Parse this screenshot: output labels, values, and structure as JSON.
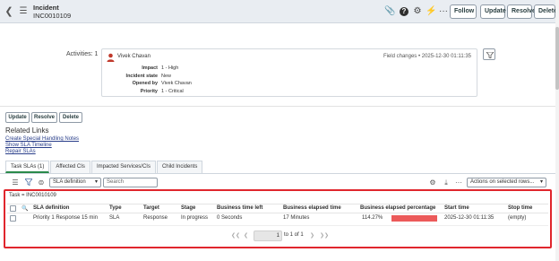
{
  "header": {
    "record_type": "Incident",
    "record_number": "INC0010109",
    "buttons": [
      "Follow",
      "Update",
      "Resolve",
      "Delete"
    ]
  },
  "activities": {
    "label": "Activities: 1",
    "author": "Vivek Chavan",
    "change_meta": "Field changes  •  2025-12-30 01:11:35",
    "fields": [
      {
        "key": "Impact",
        "value": "1 - High"
      },
      {
        "key": "Incident state",
        "value": "New"
      },
      {
        "key": "Opened by",
        "value": "Vivek Chavan"
      },
      {
        "key": "Priority",
        "value": "1 - Critical"
      }
    ]
  },
  "form_buttons": [
    "Update",
    "Resolve",
    "Delete"
  ],
  "related_links": {
    "title": "Related Links",
    "links": [
      "Create Special Handling Notes",
      "Show SLA Timeline",
      "Repair SLAs"
    ]
  },
  "tabs": [
    "Task SLAs (1)",
    "Affected CIs",
    "Impacted Services/CIs",
    "Child Incidents"
  ],
  "toolbar": {
    "field_select": "SLA definition",
    "search_placeholder": "Search",
    "actions_select": "Actions on selected rows..."
  },
  "sla_table": {
    "breadcrumb": "Task = INC0010109",
    "columns": [
      "SLA definition",
      "Type",
      "Target",
      "Stage",
      "Business time left",
      "Business elapsed time",
      "Business elapsed percentage",
      "Start time",
      "Stop time"
    ],
    "row": {
      "sla_definition": "Priority 1 Response 15 min",
      "type": "SLA",
      "target": "Response",
      "stage": "In progress",
      "business_time_left": "0 Seconds",
      "business_elapsed_time": "17 Minutes",
      "business_elapsed_percentage": "114.27%",
      "start_time": "2025-12-30 01:11:35",
      "stop_time": "(empty)"
    },
    "pagination": {
      "current": "1",
      "info": "to 1 of 1"
    }
  },
  "colors": {
    "progress_bar": "#ec5a5a",
    "highlight_outline": "#e0262d",
    "active_tab": "#2a8a4a"
  }
}
